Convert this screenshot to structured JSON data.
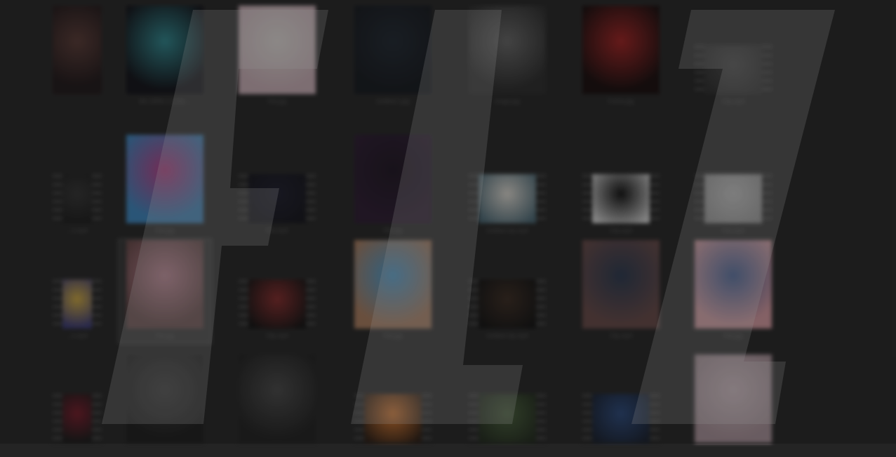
{
  "app": {
    "name": "file-browser-thumbnail-grid",
    "logo_icon": "flz-watermark-logo"
  },
  "files": [
    {
      "kind": "photo",
      "c1": "#5b3a35",
      "c2": "#1d1416",
      "label": ""
    },
    {
      "kind": "photo",
      "c1": "#2e8c94",
      "c2": "#0d0d14",
      "label": "Bin 1958s 1 (L33) ..."
    },
    {
      "kind": "photo",
      "c1": "#e8e0dc",
      "c2": "#d4b8c0",
      "label": "File.jpg"
    },
    {
      "kind": "photo",
      "c1": "#1e2630",
      "c2": "#12161c",
      "label": "Untitled-1.jpg"
    },
    {
      "kind": "photo",
      "c1": "#6a6a6a",
      "c2": "#2a2a2a",
      "label": "Image.jpg"
    },
    {
      "kind": "photo",
      "c1": "#a82020",
      "c2": "#140808",
      "label": "Frame.jpg"
    },
    {
      "kind": "video",
      "c1": "#4a4a4a",
      "c2": "#2c2c2c",
      "label": "Clip.mp4"
    },
    {
      "kind": "video",
      "c1": "#333",
      "c2": "#1a1a1a",
      "label": "...1.mp4"
    },
    {
      "kind": "photo",
      "c1": "#c0408c",
      "c2": "#3d8bc8",
      "label": "File.jpg"
    },
    {
      "kind": "video",
      "c1": "#1b1b2b",
      "c2": "#101018",
      "label": "File.mp4"
    },
    {
      "kind": "doc",
      "c1": "#1c1220",
      "c2": "#2a1830",
      "label": "File.jpg"
    },
    {
      "kind": "video",
      "c1": "#e8e4dc",
      "c2": "#4a6a78",
      "label": "Untitled clip.mp4"
    },
    {
      "kind": "video",
      "c1": "#0c0c0c",
      "c2": "#e0e0e0",
      "label": "Clip.mp4"
    },
    {
      "kind": "video",
      "c1": "#c8c8c8",
      "c2": "#9a9a9a",
      "label": "File.mp4"
    },
    {
      "kind": "video",
      "c1": "#d8b040",
      "c2": "#3a3a7a",
      "label": "...1.mp4"
    },
    {
      "kind": "photo",
      "c1": "#c88898",
      "c2": "#6a4848",
      "label": "File.jpg"
    },
    {
      "kind": "video",
      "c1": "#8a2a2a",
      "c2": "#0e0e0e",
      "label": "Clip.mp4"
    },
    {
      "kind": "photo",
      "c1": "#4aa0d8",
      "c2": "#b08060",
      "label": "File.jpg"
    },
    {
      "kind": "video",
      "c1": "#3a2a20",
      "c2": "#0e0e0e",
      "label": "Untitled clip.mp4"
    },
    {
      "kind": "photo",
      "c1": "#2a3850",
      "c2": "#6a4a48",
      "label": "Clip.mp4"
    },
    {
      "kind": "photo",
      "c1": "#3a5a98",
      "c2": "#e0a0a8",
      "label": "File.jpg"
    },
    {
      "kind": "video",
      "c1": "#7a1828",
      "c2": "#161616",
      "label": ""
    },
    {
      "kind": "photo",
      "c1": "#3a3a3a",
      "c2": "#1a1a1a",
      "label": ""
    },
    {
      "kind": "photo",
      "c1": "#4a4a4a",
      "c2": "#1e1e1e",
      "label": ""
    },
    {
      "kind": "video",
      "c1": "#e88030",
      "c2": "#2a1a10",
      "label": ""
    },
    {
      "kind": "video",
      "c1": "#48603a",
      "c2": "#1e281a",
      "label": ""
    },
    {
      "kind": "video",
      "c1": "#2a4a80",
      "c2": "#141c2c",
      "label": ""
    },
    {
      "kind": "photo",
      "c1": "#d8c0c8",
      "c2": "#b098a0",
      "label": ""
    }
  ]
}
